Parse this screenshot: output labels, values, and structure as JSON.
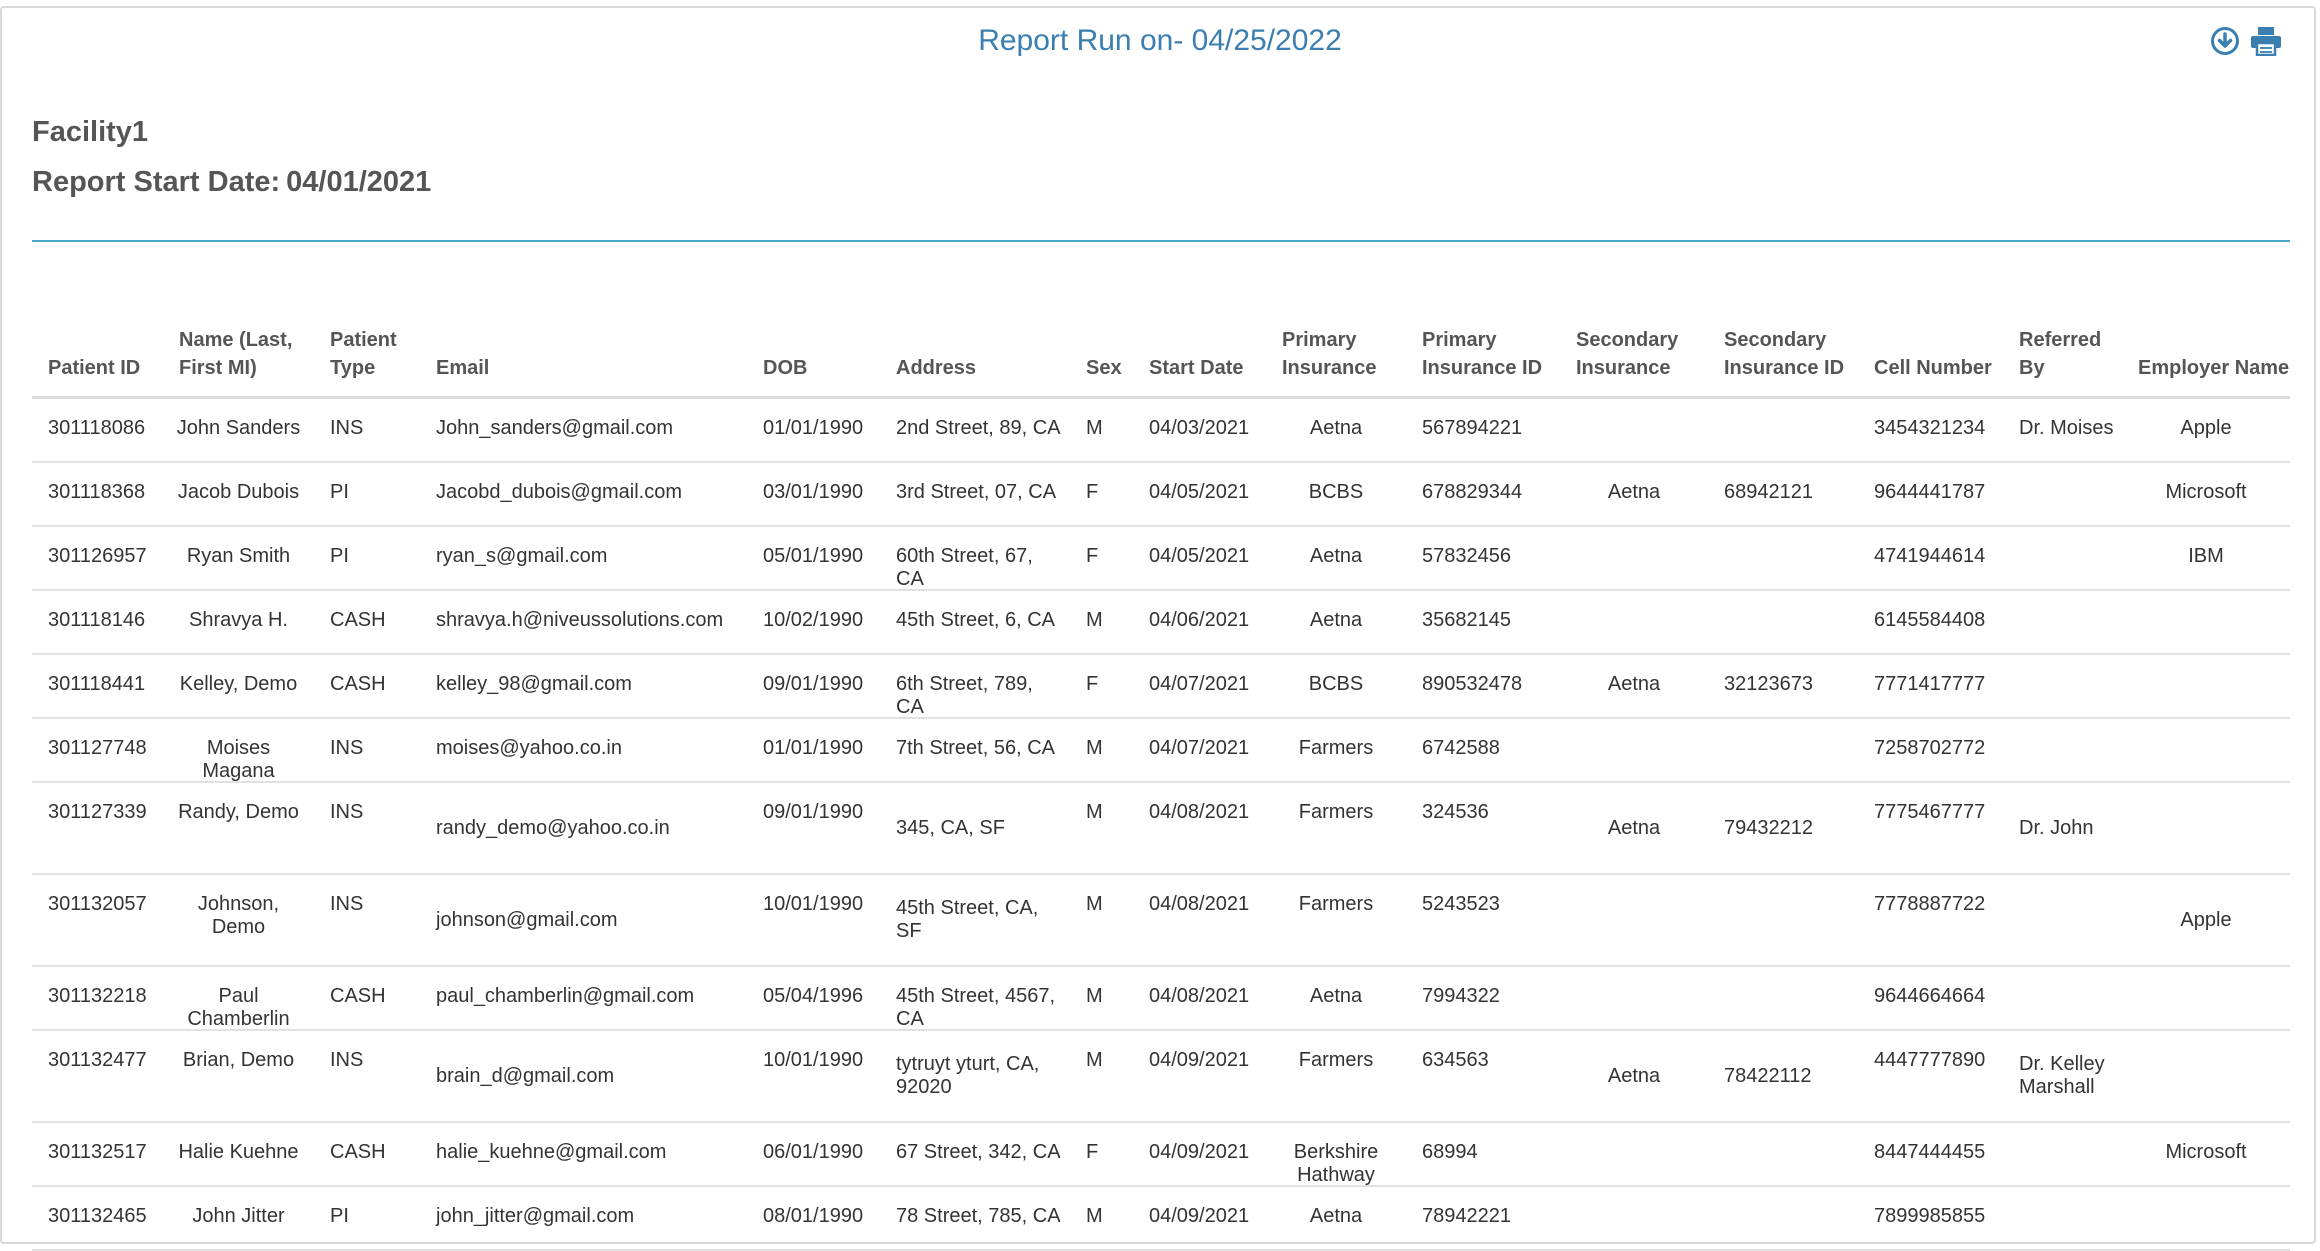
{
  "report": {
    "title": "Report Run on- 04/25/2022",
    "facility": "Facility1",
    "start_date_label": "Report Start Date:",
    "start_date_value": "04/01/2021"
  },
  "toolbar": {
    "download_icon": "download-circle-icon",
    "print_icon": "printer-icon",
    "icon_color": "#3a7fb0"
  },
  "table": {
    "columns": [
      "Patient ID",
      "Name (Last, First MI)",
      "Patient Type",
      "Email",
      "DOB",
      "Address",
      "Sex",
      "Start Date",
      "Primary Insurance",
      "Primary Insurance ID",
      "Secondary Insurance",
      "Secondary Insurance ID",
      "Cell Number",
      "Referred By",
      "Employer Name"
    ],
    "rows": [
      [
        "301118086",
        "John Sanders",
        "INS",
        "John_sanders@gmail.com",
        "01/01/1990",
        "2nd Street, 89, CA",
        "M",
        "04/03/2021",
        "Aetna",
        "567894221",
        "",
        "",
        "3454321234",
        "Dr. Moises",
        "Apple"
      ],
      [
        "301118368",
        "Jacob Dubois",
        "PI",
        "Jacobd_dubois@gmail.com",
        "03/01/1990",
        "3rd Street, 07, CA",
        "F",
        "04/05/2021",
        "BCBS",
        "678829344",
        "Aetna",
        "68942121",
        "9644441787",
        "",
        "Microsoft"
      ],
      [
        "301126957",
        "Ryan Smith",
        "PI",
        "ryan_s@gmail.com",
        "05/01/1990",
        "60th Street, 67, CA",
        "F",
        "04/05/2021",
        "Aetna",
        "57832456",
        "",
        "",
        "4741944614",
        "",
        "IBM"
      ],
      [
        "301118146",
        "Shravya H.",
        "CASH",
        "shravya.h@niveussolutions.com",
        "10/02/1990",
        "45th Street, 6, CA",
        "M",
        "04/06/2021",
        "Aetna",
        "35682145",
        "",
        "",
        "6145584408",
        "",
        ""
      ],
      [
        "301118441",
        "Kelley, Demo",
        "CASH",
        "kelley_98@gmail.com",
        "09/01/1990",
        "6th Street, 789, CA",
        "F",
        "04/07/2021",
        "BCBS",
        "890532478",
        "Aetna",
        "32123673",
        "7771417777",
        "",
        ""
      ],
      [
        "301127748",
        "Moises Magana",
        "INS",
        "moises@yahoo.co.in",
        "01/01/1990",
        "7th Street, 56, CA",
        "M",
        "04/07/2021",
        "Farmers",
        "6742588",
        "",
        "",
        "7258702772",
        "",
        ""
      ],
      [
        "301127339",
        "Randy, Demo",
        "INS",
        "randy_demo@yahoo.co.in",
        "09/01/1990",
        "345, CA, SF",
        "M",
        "04/08/2021",
        "Farmers",
        "324536",
        "Aetna",
        "79432212",
        "7775467777",
        "Dr. John",
        ""
      ],
      [
        "301132057",
        "Johnson, Demo",
        "INS",
        "johnson@gmail.com",
        "10/01/1990",
        "45th Street, CA, SF",
        "M",
        "04/08/2021",
        "Farmers",
        "5243523",
        "",
        "",
        "7778887722",
        "",
        "Apple"
      ],
      [
        "301132218",
        "Paul Chamberlin",
        "CASH",
        "paul_chamberlin@gmail.com",
        "05/04/1996",
        "45th Street, 4567, CA",
        "M",
        "04/08/2021",
        "Aetna",
        "7994322",
        "",
        "",
        "9644664664",
        "",
        ""
      ],
      [
        "301132477",
        "Brian, Demo",
        "INS",
        "brain_d@gmail.com",
        "10/01/1990",
        "tytruyt yturt, CA, 92020",
        "M",
        "04/09/2021",
        "Farmers",
        "634563",
        "Aetna",
        "78422112",
        "4447777890",
        "Dr. Kelley Marshall",
        ""
      ],
      [
        "301132517",
        "Halie Kuehne",
        "CASH",
        "halie_kuehne@gmail.com",
        "06/01/1990",
        "67 Street, 342, CA",
        "F",
        "04/09/2021",
        "Berkshire Hathway",
        "68994",
        "",
        "",
        "8447444455",
        "",
        "Microsoft"
      ],
      [
        "301132465",
        "John Jitter",
        "PI",
        "john_jitter@gmail.com",
        "08/01/1990",
        "78 Street, 785, CA",
        "M",
        "04/09/2021",
        "Aetna",
        "78942221",
        "",
        "",
        "7899985855",
        "",
        ""
      ]
    ]
  }
}
